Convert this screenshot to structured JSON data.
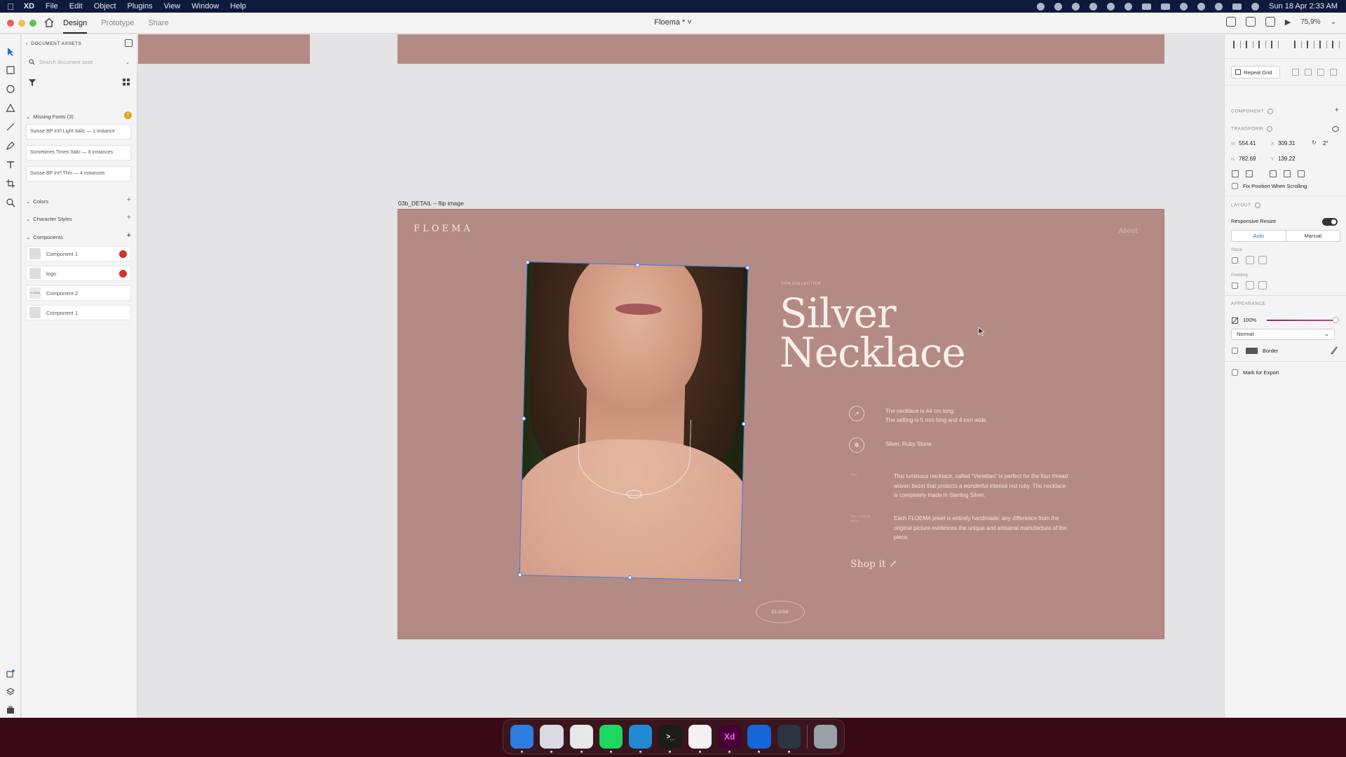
{
  "menubar": {
    "app_name": "XD",
    "menus": [
      "File",
      "Edit",
      "Object",
      "Plugins",
      "View",
      "Window",
      "Help"
    ],
    "clock": "Sun 18 Apr  2:33 AM"
  },
  "titlebar": {
    "tabs": [
      "Design",
      "Prototype",
      "Share"
    ],
    "active_tab": "Design",
    "document_title": "Floema * ˅",
    "zoom": "75,9%"
  },
  "assets": {
    "header": "DOCUMENT ASSETS",
    "search_placeholder": "Search document asse",
    "missing_fonts_label": "Missing Fonts (3)",
    "missing_fonts_badge": "!",
    "missing_fonts": [
      "Suisse BP Int'l Light Italic — 1 instance",
      "Sometimes Times Italic — 8 instances",
      "Suisse BP Int'l Thin — 4 instances"
    ],
    "colors_label": "Colors",
    "char_styles_label": "Character Styles",
    "components_label": "Components",
    "components": [
      {
        "name": "Component 1",
        "linked": true
      },
      {
        "name": "logo",
        "linked": true
      },
      {
        "name": "Component 2",
        "linked": false,
        "thumb_text": "FLOEMA"
      },
      {
        "name": "Component 1",
        "linked": false
      }
    ]
  },
  "artboard": {
    "label": "03b_DETAIL – flip image",
    "brand": "FLOEMA",
    "about": "About",
    "collection": "VITA COLLECTION",
    "title_line1": "Silver",
    "title_line2": "Necklace",
    "spec1_line1": "The necklace is 44 cm long.",
    "spec1_line2": "The setting is 5 mm long and 4 mm wide.",
    "spec2": "Silver, Ruby Stone",
    "label_info": "Info",
    "desc1": "This luminous necklace, called \"Venetian\" is perfect for the four thread woven bezel that protects a wonderful intense red ruby. The necklace is completely made in Sterling Silver.",
    "label_handmade_1": "Say enough",
    "label_handmade_2": "show",
    "desc2": "Each FLOEMA jewel is entirely handmade: any difference from the original picture evidences the unique and artisanal manufacture of the piece.",
    "shop": "Shop it ↗",
    "close": "CLOSE"
  },
  "inspector": {
    "repeat_grid": "Repeat Grid",
    "component_label": "COMPONENT",
    "transform_label": "TRANSFORM",
    "w_label": "W",
    "w_value": "554.41",
    "x_label": "X",
    "x_value": "309.31",
    "rotation": "2°",
    "h_label": "H",
    "h_value": "782.69",
    "y_label": "Y",
    "y_value": "139.22",
    "fix_position": "Fix Position When Scrolling",
    "layout_label": "LAYOUT",
    "responsive_resize": "Responsive Resize",
    "seg_auto": "Auto",
    "seg_manual": "Manual",
    "stack_label": "Stack",
    "padding_label": "Padding",
    "appearance_label": "APPEARANCE",
    "opacity": "100%",
    "opacity_value": 1.0,
    "blend_mode": "Normal",
    "border_label": "Border",
    "mark_export": "Mark for Export"
  },
  "dock": {
    "apps": [
      {
        "name": "Finder",
        "color": "#2f7de0",
        "glyph": ""
      },
      {
        "name": "Launchpad",
        "color": "#d8dbe3",
        "glyph": ""
      },
      {
        "name": "Chrome",
        "color": "#e8e8e8",
        "glyph": ""
      },
      {
        "name": "Spotify",
        "color": "#1ed760",
        "glyph": ""
      },
      {
        "name": "VS Code",
        "color": "#1f8ad2",
        "glyph": ""
      },
      {
        "name": "Terminal",
        "color": "#1c1c1c",
        "glyph": ">_"
      },
      {
        "name": "Slack",
        "color": "#f2f2f2",
        "glyph": ""
      },
      {
        "name": "Adobe XD",
        "color": "#470137",
        "glyph": "Xd"
      },
      {
        "name": "Maps",
        "color": "#1565d8",
        "glyph": ""
      },
      {
        "name": "QuickTime",
        "color": "#2b3440",
        "glyph": ""
      },
      {
        "name": "Trash",
        "color": "#9aa0a8",
        "glyph": ""
      }
    ]
  },
  "colors": {
    "artboard_bg": "#b48b84",
    "selection": "#3d7ad8",
    "canvas_bg": "#e4e3e6"
  }
}
